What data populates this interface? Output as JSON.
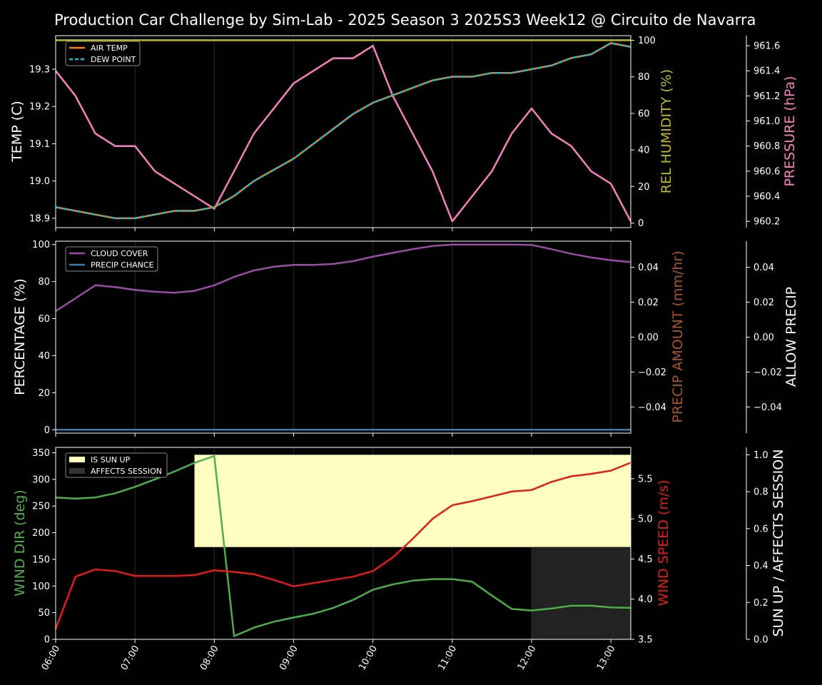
{
  "title": "Production Car Challenge by Sim-Lab - 2025 Season 3 2025S3 Week12 @ Circuito de Navarra",
  "colors": {
    "air_temp": "#ff7f0e",
    "dew_point": "#17becf",
    "humidity": "#bcbd22",
    "pressure": "#f781bf",
    "cloud": "#984ea3",
    "precip_chance": "#377eb8",
    "precip_amount": "#a65628",
    "wind_dir": "#4daf4a",
    "wind_speed": "#e41a1c",
    "sun_up": "#ffffc0",
    "affects": "#333333"
  },
  "time_ticks": [
    "06:00",
    "07:00",
    "08:00",
    "09:00",
    "10:00",
    "11:00",
    "12:00",
    "13:00"
  ],
  "chart_data": [
    {
      "type": "line",
      "x_hours": [
        6,
        6.25,
        6.5,
        6.75,
        7,
        7.25,
        7.5,
        7.75,
        8,
        8.25,
        8.5,
        8.75,
        9,
        9.25,
        9.5,
        9.75,
        10,
        10.25,
        10.5,
        10.75,
        11,
        11.25,
        11.5,
        11.75,
        12,
        12.25,
        12.5,
        12.75,
        13,
        13.25
      ],
      "ylabel": "TEMP (C)",
      "ylim": [
        18.875,
        19.39
      ],
      "yticks": [
        "18.9",
        "19.0",
        "19.1",
        "19.2",
        "19.3"
      ],
      "ytick_values": [
        18.9,
        19.0,
        19.1,
        19.2,
        19.3
      ],
      "legend": [
        "AIR TEMP",
        "DEW POINT"
      ],
      "series": [
        {
          "name": "AIR TEMP",
          "values": [
            18.93,
            18.92,
            18.91,
            18.9,
            18.9,
            18.91,
            18.92,
            18.92,
            18.93,
            18.96,
            19.0,
            19.03,
            19.06,
            19.1,
            19.14,
            19.18,
            19.21,
            19.23,
            19.25,
            19.27,
            19.28,
            19.28,
            19.29,
            19.29,
            19.3,
            19.31,
            19.33,
            19.34,
            19.37,
            19.36
          ]
        },
        {
          "name": "DEW POINT",
          "values": [
            18.93,
            18.92,
            18.91,
            18.9,
            18.9,
            18.91,
            18.92,
            18.92,
            18.93,
            18.96,
            19.0,
            19.03,
            19.06,
            19.1,
            19.14,
            19.18,
            19.21,
            19.23,
            19.25,
            19.27,
            19.28,
            19.28,
            19.29,
            19.29,
            19.3,
            19.31,
            19.33,
            19.34,
            19.37,
            19.36
          ]
        }
      ],
      "right_axis_1": {
        "label": "REL HUMIDITY (%)",
        "ylim": [
          -2.5,
          102.5
        ],
        "yticks": [
          "0",
          "20",
          "40",
          "60",
          "80",
          "100"
        ],
        "ytick_values": [
          0,
          20,
          40,
          60,
          80,
          100
        ],
        "values": [
          100,
          100,
          100,
          100,
          100,
          100,
          100,
          100,
          100,
          100,
          100,
          100,
          100,
          100,
          100,
          100,
          100,
          100,
          100,
          100,
          100,
          100,
          100,
          100,
          100,
          100,
          100,
          100,
          100,
          100
        ]
      },
      "right_axis_2": {
        "label": "PRESSURE (hPa)",
        "ylim": [
          960.15,
          961.68
        ],
        "yticks": [
          "960.2",
          "960.4",
          "960.6",
          "960.8",
          "961.0",
          "961.2",
          "961.4",
          "961.6"
        ],
        "ytick_values": [
          960.2,
          960.4,
          960.6,
          960.8,
          961.0,
          961.2,
          961.4,
          961.6
        ],
        "values": [
          961.4,
          961.2,
          960.9,
          960.8,
          960.8,
          960.6,
          960.5,
          960.4,
          960.3,
          960.6,
          960.9,
          961.1,
          961.3,
          961.4,
          961.5,
          961.5,
          961.6,
          961.2,
          960.9,
          960.6,
          960.2,
          960.4,
          960.6,
          960.9,
          961.1,
          960.9,
          960.8,
          960.6,
          960.5,
          960.2
        ]
      }
    },
    {
      "type": "line",
      "ylabel": "PERCENTAGE (%)",
      "ylim": [
        -1.8,
        101.8
      ],
      "yticks": [
        "0",
        "20",
        "40",
        "60",
        "80",
        "100"
      ],
      "ytick_values": [
        0,
        20,
        40,
        60,
        80,
        100
      ],
      "legend": [
        "CLOUD COVER",
        "PRECIP CHANCE"
      ],
      "series": [
        {
          "name": "CLOUD COVER",
          "values": [
            64,
            71,
            78,
            77,
            75.5,
            74.5,
            74,
            75,
            78,
            82.5,
            86,
            88,
            89,
            89,
            89.5,
            91,
            93.5,
            95.5,
            97.5,
            99.2,
            100,
            100,
            100,
            100,
            99.8,
            97.5,
            95,
            93,
            91.5,
            90.5
          ]
        },
        {
          "name": "PRECIP CHANCE",
          "values": [
            0,
            0,
            0,
            0,
            0,
            0,
            0,
            0,
            0,
            0,
            0,
            0,
            0,
            0,
            0,
            0,
            0,
            0,
            0,
            0,
            0,
            0,
            0,
            0,
            0,
            0,
            0,
            0,
            0,
            0
          ]
        }
      ],
      "right_axis_1": {
        "label": "PRECIP AMOUNT (mm/hr)",
        "ylim": [
          -0.055,
          0.055
        ],
        "yticks": [
          "−0.04",
          "−0.02",
          "0.00",
          "0.02",
          "0.04"
        ],
        "ytick_values": [
          -0.04,
          -0.02,
          0,
          0.02,
          0.04
        ]
      },
      "right_axis_2": {
        "label": "ALLOW PRECIP",
        "ylim": [
          -0.055,
          0.055
        ],
        "yticks": [
          "−0.04",
          "−0.02",
          "0.00",
          "0.02",
          "0.04"
        ],
        "ytick_values": [
          -0.04,
          -0.02,
          0,
          0.02,
          0.04
        ]
      }
    },
    {
      "type": "line",
      "ylabel": "WIND DIR (deg)",
      "ylim": [
        0,
        360
      ],
      "yticks": [
        "0",
        "50",
        "100",
        "150",
        "200",
        "250",
        "300",
        "350"
      ],
      "ytick_values": [
        0,
        50,
        100,
        150,
        200,
        250,
        300,
        350
      ],
      "legend": [
        "IS SUN UP",
        "AFFECTS SESSION"
      ],
      "series": [
        {
          "name": "WIND DIR",
          "values": [
            266,
            264,
            266,
            274,
            286,
            300,
            315,
            331,
            344,
            6,
            22,
            33,
            41,
            48,
            59,
            74,
            93,
            103,
            110,
            113,
            113,
            108,
            82,
            57,
            54,
            58,
            63,
            63,
            60,
            59
          ]
        }
      ],
      "right_axis_1": {
        "label": "WIND SPEED (m/s)",
        "ylim": [
          3.5,
          5.89
        ],
        "yticks": [
          "3.5",
          "4.0",
          "4.5",
          "5.0",
          "5.5"
        ],
        "ytick_values": [
          3.5,
          4.0,
          4.5,
          5.0,
          5.5
        ],
        "values": [
          3.63,
          4.28,
          4.37,
          4.35,
          4.29,
          4.29,
          4.29,
          4.3,
          4.36,
          4.34,
          4.31,
          4.24,
          4.16,
          4.2,
          4.24,
          4.28,
          4.35,
          4.52,
          4.75,
          5.0,
          5.17,
          5.22,
          5.28,
          5.34,
          5.36,
          5.46,
          5.53,
          5.56,
          5.6,
          5.7
        ]
      },
      "right_axis_2": {
        "label": "SUN UP / AFFECTS SESSION",
        "ylim": [
          0,
          1.04
        ],
        "yticks": [
          "0.0",
          "0.2",
          "0.4",
          "0.6",
          "0.8",
          "1.0"
        ],
        "ytick_values": [
          0,
          0.2,
          0.4,
          0.6,
          0.8,
          1.0
        ]
      },
      "sun_up": {
        "start": 7.75,
        "end": 13.25,
        "low": 0.5,
        "high": 1.0
      },
      "affects_session": {
        "start": 12.0,
        "end": 13.25,
        "low": 0.0,
        "high": 0.5
      }
    }
  ]
}
